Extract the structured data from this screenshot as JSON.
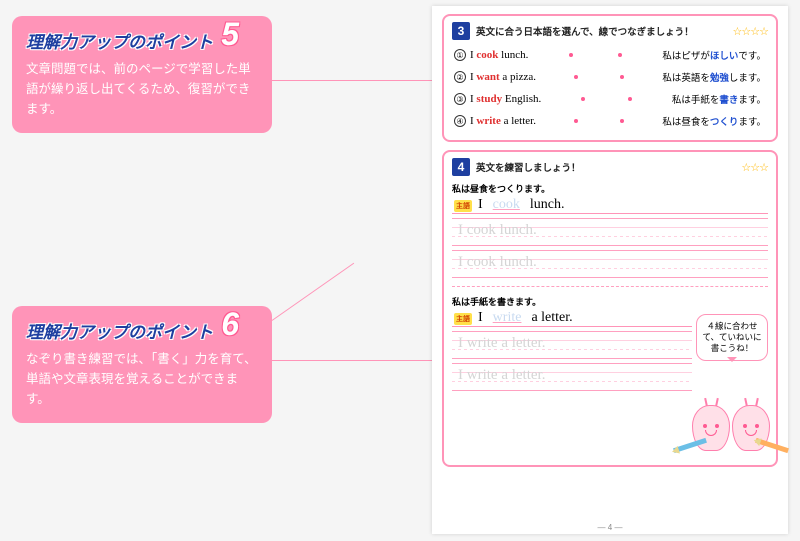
{
  "callouts": [
    {
      "title": "理解力アップのポイント",
      "num": "5",
      "body": "文章問題では、前のページで学習した単語が繰り返し出てくるため、復習ができます。"
    },
    {
      "title": "理解力アップのポイント",
      "num": "6",
      "body": "なぞり書き練習では、「書く」力を育て、単語や文章表現を覚えることができます。"
    }
  ],
  "section3": {
    "num": "3",
    "title": "英文に合う日本語を選んで、線でつなぎましょう！",
    "stars": "☆☆☆☆",
    "rows": [
      {
        "n": "①",
        "pre": "I ",
        "kw": "cook",
        "post": " lunch.",
        "jp_pre": "私はピザが",
        "jp_kw": "ほしい",
        "jp_post": "です。"
      },
      {
        "n": "②",
        "pre": "I ",
        "kw": "want",
        "post": " a pizza.",
        "jp_pre": "私は英語を",
        "jp_kw": "勉強",
        "jp_post": "します。"
      },
      {
        "n": "③",
        "pre": "I ",
        "kw": "study",
        "post": " English.",
        "jp_pre": "私は手紙を",
        "jp_kw": "書き",
        "jp_post": "ます。"
      },
      {
        "n": "④",
        "pre": "I ",
        "kw": "write",
        "post": " a letter.",
        "jp_pre": "私は昼食を",
        "jp_kw": "つくり",
        "jp_post": "ます。"
      }
    ]
  },
  "section4": {
    "num": "4",
    "title": "英文を練習しましょう！",
    "stars": "☆☆☆",
    "tag": "主語",
    "items": [
      {
        "prompt": "私は昼食をつくります。",
        "lead": "I",
        "blank": "cook",
        "tail": "lunch.",
        "trace": "I cook lunch."
      },
      {
        "prompt": "私は手紙を書きます。",
        "lead": "I",
        "blank": "write",
        "tail": "a letter.",
        "trace": "I write a letter."
      }
    ]
  },
  "bubble": "４線に合わせて、ていねいに書こうね！",
  "page_num": "— 4 —"
}
